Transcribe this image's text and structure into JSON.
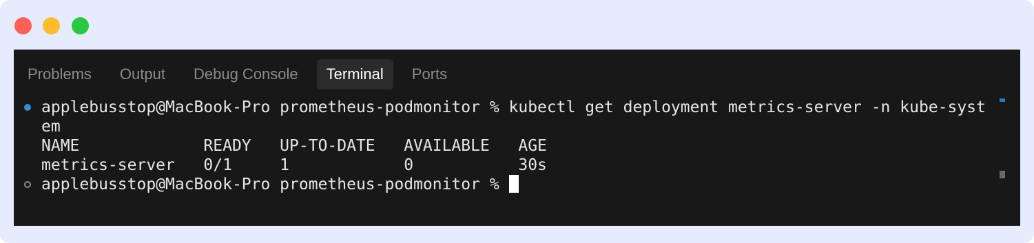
{
  "window": {
    "controls": [
      "close",
      "minimize",
      "zoom"
    ]
  },
  "colors": {
    "close": "#fe5f57",
    "minimize": "#febc2e",
    "zoom": "#28c840",
    "success_marker": "#3c8cc8",
    "scroll_accent": "#1d7fbf"
  },
  "panel": {
    "tabs": [
      {
        "label": "Problems",
        "active": false
      },
      {
        "label": "Output",
        "active": false
      },
      {
        "label": "Debug Console",
        "active": false
      },
      {
        "label": "Terminal",
        "active": true
      },
      {
        "label": "Ports",
        "active": false
      }
    ]
  },
  "terminal": {
    "lines": [
      "applebusstop@MacBook-Pro prometheus-podmonitor % kubectl get deployment metrics-server -n kube-syst",
      "em",
      "NAME             READY   UP-TO-DATE   AVAILABLE   AGE",
      "metrics-server   0/1     1            0           30s",
      "applebusstop@MacBook-Pro prometheus-podmonitor % "
    ]
  }
}
